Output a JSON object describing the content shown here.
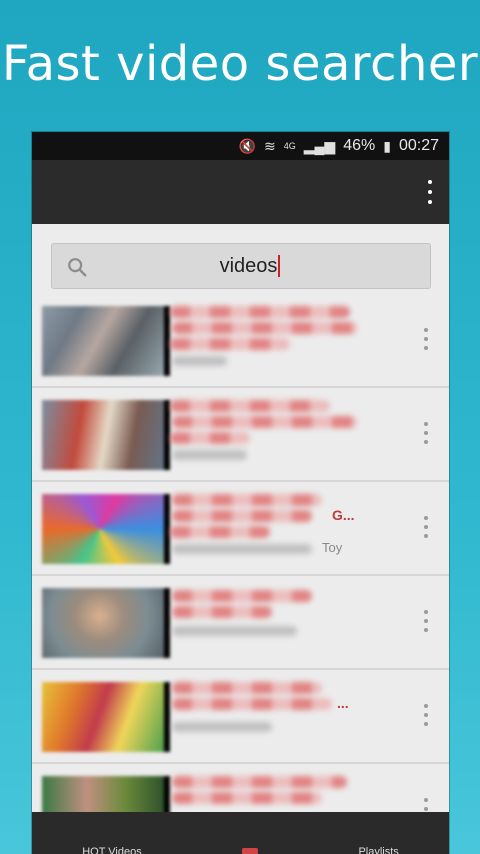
{
  "promo": {
    "title": "Fast video searcher"
  },
  "status_bar": {
    "wifi": "4G",
    "battery": "46%",
    "time": "00:27"
  },
  "search": {
    "value": "videos"
  },
  "results": [
    {
      "title_fragment": "",
      "subtitle_fragment": ""
    },
    {
      "title_fragment": "",
      "subtitle_fragment": ""
    },
    {
      "title_fragment": "G...",
      "subtitle_fragment": "Toy"
    },
    {
      "title_fragment": "",
      "subtitle_fragment": ""
    },
    {
      "title_fragment": "...",
      "subtitle_fragment": ""
    },
    {
      "title_fragment": "",
      "subtitle_fragment": ""
    }
  ],
  "bottom_nav": {
    "tabs": [
      "HOT Videos",
      "",
      "Playlists"
    ]
  },
  "colors": {
    "accent": "#d04545",
    "background": "#2fb8cf"
  }
}
